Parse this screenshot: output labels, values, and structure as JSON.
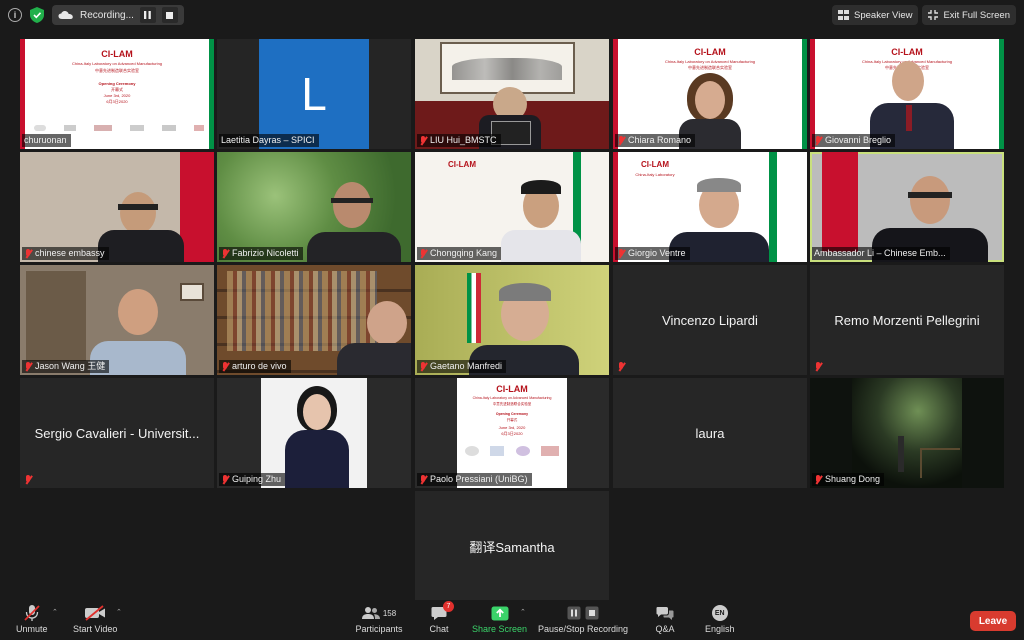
{
  "topbar": {
    "recording_label": "Recording...",
    "speaker_view_label": "Speaker View",
    "exit_full_screen_label": "Exit Full Screen"
  },
  "tiles": [
    {
      "name": "churuonan"
    },
    {
      "name": "Laetitia Dayras – SPICI",
      "initial": "L"
    },
    {
      "name": "LIU Hui_BMSTC"
    },
    {
      "name": "Chiara Romano"
    },
    {
      "name": "Giovanni Breglio"
    },
    {
      "name": "chinese embassy"
    },
    {
      "name": "Fabrizio Nicoletti"
    },
    {
      "name": "Chongqing Kang"
    },
    {
      "name": "Giorgio Ventre"
    },
    {
      "name": "Ambassador Li – Chinese Emb..."
    },
    {
      "name": "Jason Wang 王健"
    },
    {
      "name": "arturo de vivo"
    },
    {
      "name": "Gaetano Manfredi"
    },
    {
      "name": "Vincenzo Lipardi"
    },
    {
      "name": "Remo Morzenti Pellegrini"
    },
    {
      "name": "Sergio Cavalieri - Universit..."
    },
    {
      "name": "Guiping Zhu"
    },
    {
      "name": "Paolo Pressiani (UniBG)"
    },
    {
      "name": "laura"
    },
    {
      "name": "Shuang Dong"
    },
    {
      "name": "翻译Samantha"
    }
  ],
  "slide": {
    "title": "CI-LAM",
    "subtitle": "China-Italy Laboratory on Advanced Manufacturing",
    "cn_subtitle": "中意先进制造联合实验室",
    "ceremony": "Opening Ceremony",
    "cn_ceremony": "开幕式",
    "date": "June 3rd, 2020",
    "cn_date": "6月3日2020"
  },
  "toolbar": {
    "unmute": "Unmute",
    "start_video": "Start Video",
    "participants": "Participants",
    "participants_count": "158",
    "chat": "Chat",
    "chat_badge": "7",
    "share_screen": "Share Screen",
    "pause_recording": "Pause/Stop Recording",
    "qa": "Q&A",
    "english": "English",
    "english_code": "EN",
    "leave": "Leave"
  },
  "colors": {
    "accent_green": "#3bd36a",
    "leave_red": "#d83b2f",
    "active_speaker": "#c9e07d"
  }
}
